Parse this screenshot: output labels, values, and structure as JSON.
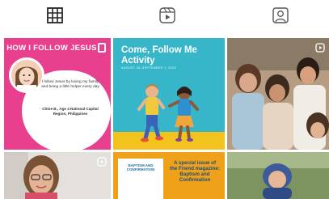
{
  "tabs": [
    {
      "name": "grid",
      "icon": "grid-icon",
      "active": true
    },
    {
      "name": "reels",
      "icon": "reels-icon",
      "active": false
    },
    {
      "name": "tagged",
      "icon": "tagged-person-icon",
      "active": false
    }
  ],
  "posts": [
    {
      "header": "HOW I FOLLOW JESUS",
      "quote": "I follow Jesus by loving my family and being a little helper every day",
      "credit": "Chloe B., Age 4 National Capital Region, Philippines",
      "background": "#e8408f"
    },
    {
      "title": "Come, Follow Me Activity",
      "subtitle": "AUGUST 26–SEPTEMBER 1, 2024",
      "background": "#38b6c9"
    },
    {
      "type": "photo",
      "description_icon": "children-photo",
      "has_reel_icon": true
    },
    {
      "type": "photo",
      "has_reel_icon": true
    },
    {
      "card_text": "BAPTISM AND CONFIRMATION",
      "text": "A special issue of the Friend magazine: Baptism and Confirmation",
      "background": "#f0a11a"
    },
    {
      "type": "photo"
    }
  ],
  "colors": {
    "icon": "#262626",
    "pink": "#e8408f",
    "teal": "#38b6c9",
    "orange": "#f0a11a"
  }
}
